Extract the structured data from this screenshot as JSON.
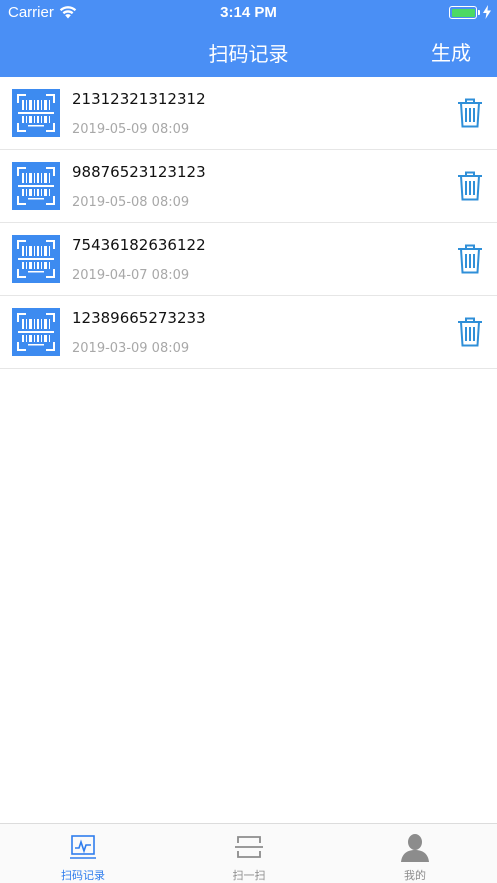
{
  "status_bar": {
    "carrier": "Carrier",
    "time": "3:14 PM"
  },
  "nav": {
    "title": "扫码记录",
    "action_label": "生成"
  },
  "records": [
    {
      "code": "21312321312312",
      "date": "2019-05-09 08:09"
    },
    {
      "code": "98876523123123",
      "date": "2019-05-08 08:09"
    },
    {
      "code": "75436182636122",
      "date": "2019-04-07 08:09"
    },
    {
      "code": "12389665273233",
      "date": "2019-03-09 08:09"
    }
  ],
  "tabs": [
    {
      "label": "扫码记录",
      "icon": "chart-screen-icon",
      "active": true
    },
    {
      "label": "扫一扫",
      "icon": "scan-frame-icon",
      "active": false
    },
    {
      "label": "我的",
      "icon": "person-icon",
      "active": false
    }
  ],
  "colors": {
    "primary": "#4a8ff5",
    "thumb_bg": "#3d8bf0",
    "trash": "#2f8fd8",
    "tab_active": "#2f7ded",
    "tab_inactive": "#8c8c8c"
  }
}
